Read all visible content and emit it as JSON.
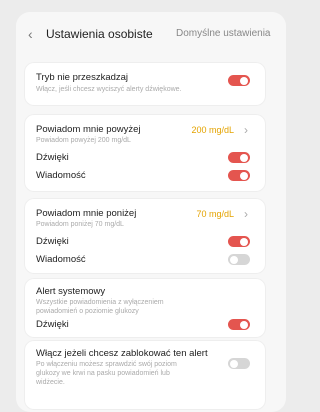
{
  "header": {
    "title": "Ustawienia osobiste",
    "right": "Domyślne ustawienia"
  },
  "sections": {
    "dnd": {
      "label": "Tryb nie przeszkadzaj",
      "sub": "Włącz, jeśli chcesz wyciszyć alerty dźwiękowe.",
      "toggle": "on"
    },
    "above": {
      "label": "Powiadom mnie powyżej",
      "sub": "Powiadom powyżej 200 mg/dL",
      "value": "200 mg/dL",
      "sound_label": "Dźwięki",
      "message_label": "Wiadomość",
      "sound_toggle": "on",
      "message_toggle": "on"
    },
    "below": {
      "label": "Powiadom mnie poniżej",
      "sub": "Powiadom poniżej 70 mg/dL",
      "value": "70 mg/dL",
      "sound_label": "Dźwięki",
      "message_label": "Wiadomość",
      "sound_toggle": "on",
      "message_toggle": "off"
    },
    "system": {
      "label": "Alert systemowy",
      "sub": "Wszystkie powiadomienia z wyłączeniem powiadomień o poziomie glukozy",
      "sound_label": "Dźwięki",
      "sound_toggle": "on"
    },
    "lock": {
      "label": "Włącz jeżeli chcesz zablokować ten alert",
      "sub": "Po włączeniu możesz sprawdzić swój poziom glukozy we krwi na pasku powiadomień lub widżecie.",
      "toggle": "off"
    }
  },
  "colors": {
    "accent": "#e4554f",
    "value": "#e4a300"
  }
}
